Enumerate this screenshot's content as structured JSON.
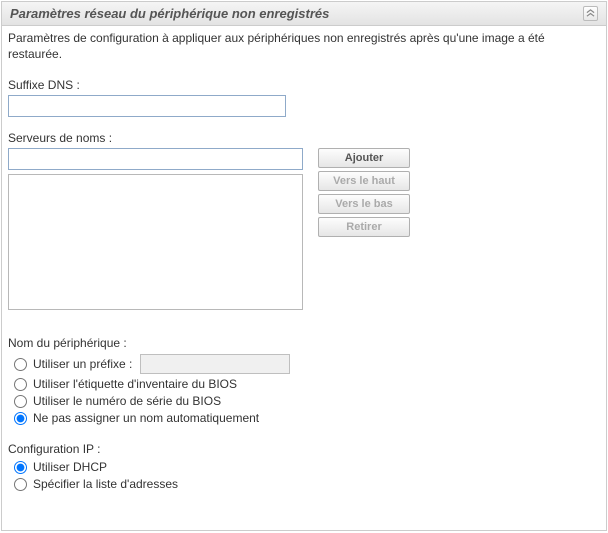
{
  "panel": {
    "title": "Paramètres réseau du périphérique non enregistrés",
    "description": "Paramètres de configuration à appliquer aux périphériques non enregistrés après qu'une image a été restaurée."
  },
  "dnsSuffix": {
    "label": "Suffixe DNS :",
    "value": ""
  },
  "nameServers": {
    "label": "Serveurs de noms :",
    "inputValue": "",
    "buttons": {
      "add": "Ajouter",
      "up": "Vers le haut",
      "down": "Vers le bas",
      "remove": "Retirer"
    }
  },
  "deviceName": {
    "label": "Nom du périphérique :",
    "options": {
      "prefix": "Utiliser un préfixe :",
      "biosAsset": "Utiliser l'étiquette d'inventaire du BIOS",
      "biosSerial": "Utiliser le numéro de série du BIOS",
      "noAuto": "Ne pas assigner un nom automatiquement"
    },
    "prefixValue": "",
    "selected": "noAuto"
  },
  "ipConfig": {
    "label": "Configuration IP :",
    "options": {
      "dhcp": "Utiliser DHCP",
      "list": "Spécifier la liste d'adresses"
    },
    "selected": "dhcp"
  }
}
